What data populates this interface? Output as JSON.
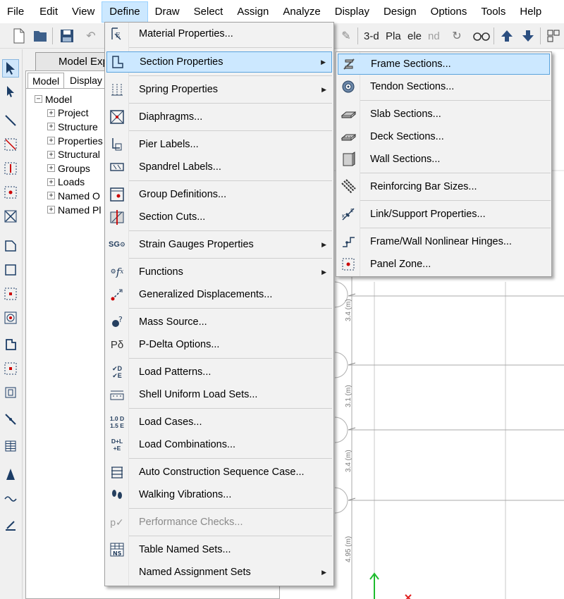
{
  "menubar": {
    "items": [
      "File",
      "Edit",
      "View",
      "Define",
      "Draw",
      "Select",
      "Assign",
      "Analyze",
      "Display",
      "Design",
      "Options",
      "Tools",
      "Help"
    ],
    "active": "Define"
  },
  "toolbar": {
    "view_3d": "3-d",
    "plan": "Pla",
    "elev": "ele",
    "nd": "nd"
  },
  "explorer": {
    "title": "Model Exp",
    "tabs": [
      "Model",
      "Display"
    ],
    "root": "Model",
    "nodes": [
      "Project",
      "Structure",
      "Properties",
      "Structural",
      "Groups",
      "Loads",
      "Named O",
      "Named Pl"
    ]
  },
  "canvas": {
    "dims": [
      "3.4 (m)",
      "3.1 (m)",
      "3.4 (m)",
      "4.95 (m)"
    ],
    "axis_y": "Y"
  },
  "define_menu": {
    "items": [
      {
        "label": "Material Properties...",
        "icon": "material-icon"
      },
      {
        "label": "Section Properties",
        "icon": "section-icon",
        "submenu": true
      },
      {
        "label": "Spring Properties",
        "icon": "spring-icon",
        "submenu": true
      },
      {
        "label": "Diaphragms...",
        "icon": "diaphragm-icon"
      },
      {
        "label": "Pier Labels...",
        "icon": "pier-icon"
      },
      {
        "label": "Spandrel Labels...",
        "icon": "spandrel-icon"
      },
      {
        "label": "Group Definitions...",
        "icon": "group-icon"
      },
      {
        "label": "Section Cuts...",
        "icon": "section-cut-icon"
      },
      {
        "label": "Strain Gauges Properties",
        "icon": "strain-gauge-icon",
        "submenu": true
      },
      {
        "label": "Functions",
        "icon": "function-icon",
        "submenu": true
      },
      {
        "label": "Generalized Displacements...",
        "icon": "displacement-icon"
      },
      {
        "label": "Mass Source...",
        "icon": "mass-icon"
      },
      {
        "label": "P-Delta Options...",
        "icon": "pdelta-icon"
      },
      {
        "label": "Load Patterns...",
        "icon": "load-pattern-icon"
      },
      {
        "label": "Shell Uniform Load Sets...",
        "icon": "shell-load-icon"
      },
      {
        "label": "Load Cases...",
        "icon": "load-case-icon"
      },
      {
        "label": "Load Combinations...",
        "icon": "load-combo-icon"
      },
      {
        "label": "Auto Construction Sequence Case...",
        "icon": "construction-icon"
      },
      {
        "label": "Walking Vibrations...",
        "icon": "walking-icon"
      },
      {
        "label": "Performance Checks...",
        "icon": "performance-icon",
        "disabled": true
      },
      {
        "label": "Table Named Sets...",
        "icon": "table-icon"
      },
      {
        "label": "Named Assignment Sets",
        "icon": "assignment-icon",
        "submenu": true
      }
    ],
    "icon_text": {
      "strain": "SG",
      "pdelta": "Pδ",
      "loadpattern": [
        "✔D",
        "✔E"
      ],
      "loadcase": [
        "1.0 D",
        "1.5 E"
      ],
      "loadcombo": [
        "D+L",
        "+E"
      ],
      "table": "NS"
    }
  },
  "section_menu": {
    "items": [
      {
        "label": "Frame Sections...",
        "icon": "frame-section-icon"
      },
      {
        "label": "Tendon Sections...",
        "icon": "tendon-icon"
      },
      {
        "label": "Slab Sections...",
        "icon": "slab-icon"
      },
      {
        "label": "Deck Sections...",
        "icon": "deck-icon"
      },
      {
        "label": "Wall Sections...",
        "icon": "wall-icon"
      },
      {
        "label": "Reinforcing Bar Sizes...",
        "icon": "rebar-icon"
      },
      {
        "label": "Link/Support Properties...",
        "icon": "link-icon"
      },
      {
        "label": "Frame/Wall Nonlinear Hinges...",
        "icon": "hinge-icon"
      },
      {
        "label": "Panel Zone...",
        "icon": "panel-zone-icon"
      }
    ]
  }
}
